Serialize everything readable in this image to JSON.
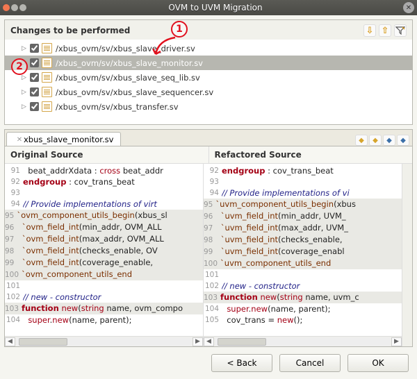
{
  "window": {
    "title": "OVM to UVM Migration"
  },
  "changes": {
    "heading": "Changes to be performed",
    "items": [
      {
        "path": "/xbus_ovm/sv/xbus_slave_driver.sv",
        "checked": true,
        "selected": false
      },
      {
        "path": "/xbus_ovm/sv/xbus_slave_monitor.sv",
        "checked": true,
        "selected": true
      },
      {
        "path": "/xbus_ovm/sv/xbus_slave_seq_lib.sv",
        "checked": true,
        "selected": false
      },
      {
        "path": "/xbus_ovm/sv/xbus_slave_sequencer.sv",
        "checked": true,
        "selected": false
      },
      {
        "path": "/xbus_ovm/sv/xbus_transfer.sv",
        "checked": true,
        "selected": false
      }
    ]
  },
  "tab": {
    "label": "xbus_slave_monitor.sv"
  },
  "diff": {
    "left_header": "Original Source",
    "right_header": "Refactored Source",
    "left_lines": [
      {
        "n": 91,
        "html": "  beat_addrXdata : <span class='kw2'>cross</span> beat_addr"
      },
      {
        "n": 92,
        "html": "<span class='kw'>endgroup</span> : cov_trans_beat"
      },
      {
        "n": 93,
        "html": ""
      },
      {
        "n": 94,
        "html": "<span class='cm'>// Provide implementations of virt</span>"
      },
      {
        "n": 95,
        "html": "<span class='mac'>`ovm_component_utils_begin</span>(xbus_sl",
        "hi": true
      },
      {
        "n": 96,
        "html": "  <span class='mac'>`ovm_field_int</span>(min_addr, OVM_ALL",
        "hi": true
      },
      {
        "n": 97,
        "html": "  <span class='mac'>`ovm_field_int</span>(max_addr, OVM_ALL",
        "hi": true
      },
      {
        "n": 98,
        "html": "  <span class='mac'>`ovm_field_int</span>(checks_enable, OV",
        "hi": true
      },
      {
        "n": 99,
        "html": "  <span class='mac'>`ovm_field_int</span>(coverage_enable, ",
        "hi": true
      },
      {
        "n": 100,
        "html": "<span class='mac'>`ovm_component_utils_end</span>",
        "hi": true
      },
      {
        "n": 101,
        "html": ""
      },
      {
        "n": 102,
        "html": "<span class='cm'>// new - constructor</span>"
      },
      {
        "n": 103,
        "html": "<span class='kw'>function</span> <span class='kw2'>new</span>(<span class='kw2'>string</span> name, ovm_compo",
        "hi": true
      },
      {
        "n": 104,
        "html": "  <span class='kw2'>super</span>.<span class='kw2'>new</span>(name, parent);"
      }
    ],
    "right_lines": [
      {
        "n": 92,
        "html": "<span class='kw'>endgroup</span> : cov_trans_beat"
      },
      {
        "n": 93,
        "html": ""
      },
      {
        "n": 94,
        "html": "<span class='cm'>// Provide implementations of vi</span>"
      },
      {
        "n": 95,
        "html": "<span class='mac'>`uvm_component_utils_begin</span>(xbus",
        "hi": true
      },
      {
        "n": 96,
        "html": "  <span class='mac'>`uvm_field_int</span>(min_addr, UVM_",
        "hi": true
      },
      {
        "n": 97,
        "html": "  <span class='mac'>`uvm_field_int</span>(max_addr, UVM_",
        "hi": true
      },
      {
        "n": 98,
        "html": "  <span class='mac'>`uvm_field_int</span>(checks_enable,",
        "hi": true
      },
      {
        "n": 99,
        "html": "  <span class='mac'>`uvm_field_int</span>(coverage_enabl",
        "hi": true
      },
      {
        "n": 100,
        "html": "<span class='mac'>`uvm_component_utils_end</span>",
        "hi": true
      },
      {
        "n": 101,
        "html": ""
      },
      {
        "n": 102,
        "html": "<span class='cm'>// new - constructor</span>"
      },
      {
        "n": 103,
        "html": "<span class='kw'>function</span> <span class='kw2'>new</span>(<span class='kw2'>string</span> name, uvm_c",
        "hi": true
      },
      {
        "n": 104,
        "html": "  <span class='kw2'>super</span>.<span class='kw2'>new</span>(name, parent);"
      },
      {
        "n": 105,
        "html": "  cov_trans = <span class='kw2'>new</span>();"
      }
    ]
  },
  "buttons": {
    "back": "< Back",
    "cancel": "Cancel",
    "ok": "OK"
  },
  "callouts": {
    "c1": "1",
    "c2": "2"
  }
}
